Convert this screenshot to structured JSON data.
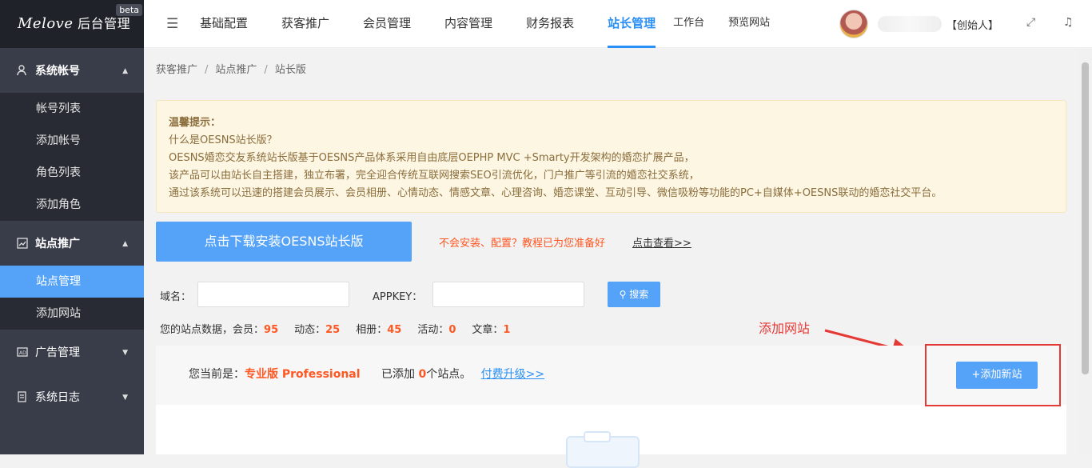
{
  "logo": {
    "brand_script": "Melove",
    "brand_text": "后台管理",
    "badge": "beta"
  },
  "sidebar": {
    "groups": [
      {
        "label": "系统帐号",
        "icon": "user-icon",
        "expanded": true,
        "items": [
          {
            "label": "帐号列表"
          },
          {
            "label": "添加帐号"
          },
          {
            "label": "角色列表"
          },
          {
            "label": "添加角色"
          }
        ]
      },
      {
        "label": "站点推广",
        "icon": "chart-icon",
        "expanded": true,
        "items": [
          {
            "label": "站点管理",
            "active": true
          },
          {
            "label": "添加网站"
          }
        ]
      },
      {
        "label": "广告管理",
        "icon": "ad-icon",
        "expanded": false
      },
      {
        "label": "系统日志",
        "icon": "log-icon",
        "expanded": false
      }
    ]
  },
  "topnav": {
    "items": [
      {
        "label": "基础配置"
      },
      {
        "label": "获客推广"
      },
      {
        "label": "会员管理"
      },
      {
        "label": "内容管理"
      },
      {
        "label": "财务报表"
      },
      {
        "label": "站长管理",
        "active": true
      },
      {
        "label": "工作台"
      },
      {
        "label": "预览网站"
      }
    ],
    "user_role": "【创始人】"
  },
  "breadcrumb": [
    "获客推广",
    "站点推广",
    "站长版"
  ],
  "notice": {
    "title": "温馨提示：",
    "lines": [
      "什么是OESNS站长版？",
      "OESNS婚恋交友系统站长版基于OESNS产品体系采用自由底层OEPHP MVC +Smarty开发架构的婚恋扩展产品，",
      "该产品可以由站长自主搭建，独立布署，完全迎合传统互联网搜索SEO引流优化，门户推广等引流的婚恋社交系统，",
      "通过该系统可以迅速的搭建会员展示、会员相册、心情动态、情感文章、心理咨询、婚恋课堂、互动引导、微信吸粉等功能的PC+自媒体+OESNS联动的婚恋社交平台。"
    ]
  },
  "download": {
    "button": "点击下载安装OESNS站长版",
    "tip": "不会安装、配置？教程已为您准备好",
    "link": "点击查看>>"
  },
  "search": {
    "domain_label": "域名：",
    "appkey_label": "APPKEY：",
    "domain_value": "",
    "appkey_value": "",
    "button": "搜索"
  },
  "stats": {
    "prefix": "您的站点数据，",
    "items": [
      {
        "label": "会员：",
        "value": "95"
      },
      {
        "label": "动态：",
        "value": "25"
      },
      {
        "label": "相册：",
        "value": "45"
      },
      {
        "label": "活动：",
        "value": "0"
      },
      {
        "label": "文章：",
        "value": "1"
      }
    ]
  },
  "annotation": {
    "text": "添加网站",
    "color": "#e53935"
  },
  "plan": {
    "current_prefix": "您当前是：",
    "plan_name": "专业版 Professional",
    "added_prefix": "已添加 ",
    "count": "0",
    "added_suffix": "个站点。",
    "upgrade": "付费升级>>",
    "add_button": "+添加新站"
  },
  "colors": {
    "accent": "#55a3f8",
    "active_nav": "#2b90f5",
    "highlight": "#ff5722",
    "sidebar": "#393d49"
  }
}
